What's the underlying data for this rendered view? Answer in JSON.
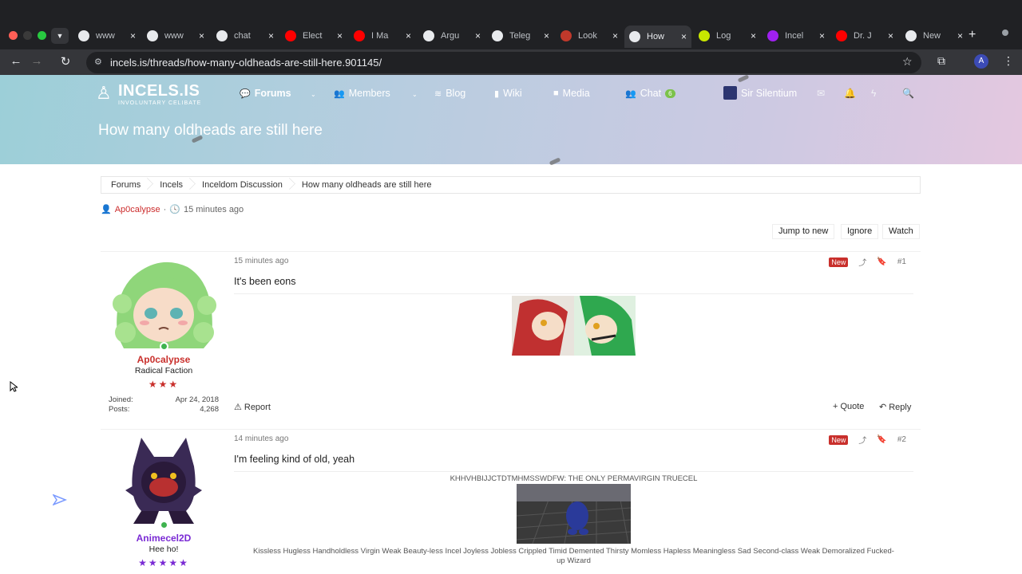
{
  "browser": {
    "tabs": [
      {
        "title": "www",
        "icon": "google-icon",
        "color": "#ffffff"
      },
      {
        "title": "www",
        "icon": "google-icon",
        "color": "#ffffff"
      },
      {
        "title": "chat",
        "icon": "openai-icon",
        "color": "#ffffff"
      },
      {
        "title": "Elect",
        "icon": "youtube-icon",
        "color": "#ff0000"
      },
      {
        "title": "I Ma",
        "icon": "youtube-icon",
        "color": "#ff0000"
      },
      {
        "title": "Argu",
        "icon": "openai-icon",
        "color": "#ffffff"
      },
      {
        "title": "Teleg",
        "icon": "globe-icon",
        "color": "#ffffff"
      },
      {
        "title": "Look",
        "icon": "bookmark-icon",
        "color": "#c0392b"
      },
      {
        "title": "How",
        "icon": "incels-icon",
        "color": "#ffffff"
      },
      {
        "title": "Log",
        "icon": "linux-icon",
        "color": "#c8e600"
      },
      {
        "title": "Incel",
        "icon": "incels-icon",
        "color": "#a020f0"
      },
      {
        "title": "Dr. J",
        "icon": "youtube-icon",
        "color": "#ff0000"
      },
      {
        "title": "New",
        "icon": "openai-icon",
        "color": "#ffffff"
      }
    ],
    "active_tab": 8,
    "url": "incels.is/threads/how-many-oldheads-are-still-here.901145/",
    "profile_initial": "A"
  },
  "site": {
    "logo_main": "INCELS.IS",
    "logo_sub": "INVOLUNTARY CELIBATE",
    "nav": {
      "forums": "Forums",
      "members": "Members",
      "blog": "Blog",
      "wiki": "Wiki",
      "media": "Media",
      "chat": "Chat",
      "chat_count": "6"
    },
    "user": "Sir Silentium",
    "page_title": "How many oldheads are still here"
  },
  "breadcrumbs": [
    "Forums",
    "Incels",
    "Inceldom Discussion",
    "How many oldheads are still here"
  ],
  "thread": {
    "author": "Ap0calypse",
    "time": "15 minutes ago",
    "separator": "·"
  },
  "actions": {
    "jump": "Jump to new",
    "ignore": "Ignore",
    "watch": "Watch"
  },
  "posts": [
    {
      "username": "Ap0calypse",
      "username_color": "#c9302c",
      "user_title": "Radical Faction",
      "stars": "★★★",
      "star_color": "#c9302c",
      "joined_label": "Joined:",
      "joined": "Apr 24, 2018",
      "posts_label": "Posts:",
      "posts": "4,268",
      "date": "15 minutes ago",
      "badge": "New",
      "number": "#1",
      "body": "It's been eons",
      "report": "Report",
      "quote": "Quote",
      "reply": "Reply"
    },
    {
      "username": "Animecel2D",
      "username_color": "#7a2ad4",
      "user_title": "Hee ho!",
      "stars": "★★★★★",
      "star_color": "#7a2ad4",
      "date": "14 minutes ago",
      "badge": "New",
      "number": "#2",
      "body": "I'm feeling kind of old, yeah",
      "sig_title": "KHHVHBIJJCTDTMHMSSWDFW: THE ONLY PERMAVIRGIN TRUECEL",
      "sig_text": "Kissless Hugless Handholdless Virgin Weak Beauty-less Incel Joyless Jobless Crippled Timid Demented Thirsty Momless Hapless Meaningless Sad Second-class Weak Demoralized Fucked-up Wizard"
    }
  ]
}
